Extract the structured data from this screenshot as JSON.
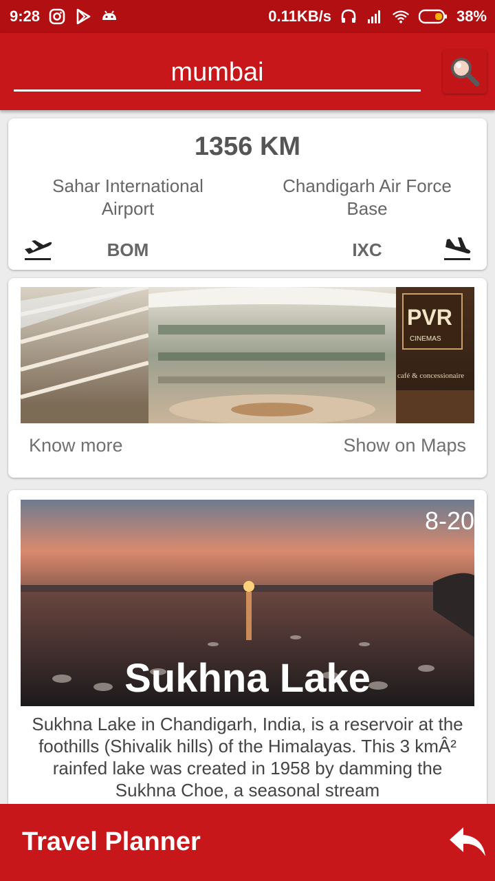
{
  "status_bar": {
    "time": "9:28",
    "network_speed": "0.11KB/s",
    "battery": "38%",
    "icons": [
      "instagram-icon",
      "play-store-icon",
      "android-icon",
      "headset-icon",
      "signal-icon",
      "wifi-icon",
      "battery-icon"
    ]
  },
  "search": {
    "value": "mumbai",
    "icon": "search-icon"
  },
  "route": {
    "distance": "1356 KM",
    "from_name": "Sahar International Airport",
    "to_name": "Chandigarh Air Force Base",
    "from_code": "BOM",
    "to_code": "IXC"
  },
  "place_card": {
    "know_more": "Know more",
    "show_on_maps": "Show on Maps",
    "photo_sign": "PVR",
    "photo_sign_sub": "CINEMAS",
    "photo_sign_sub2": "café & concessionaire"
  },
  "lake_card": {
    "rating": "8-20",
    "title": "Sukhna Lake",
    "description": "Sukhna Lake in Chandigarh, India, is a reservoir at the foothills (Shivalik hills) of the Himalayas. This 3 kmÂ² rainfed lake was created in 1958 by damming the Sukhna Choe, a seasonal stream"
  },
  "bottom_bar": {
    "title": "Travel Planner"
  },
  "colors": {
    "primary": "#c8171b",
    "status_bar": "#b10f12"
  }
}
